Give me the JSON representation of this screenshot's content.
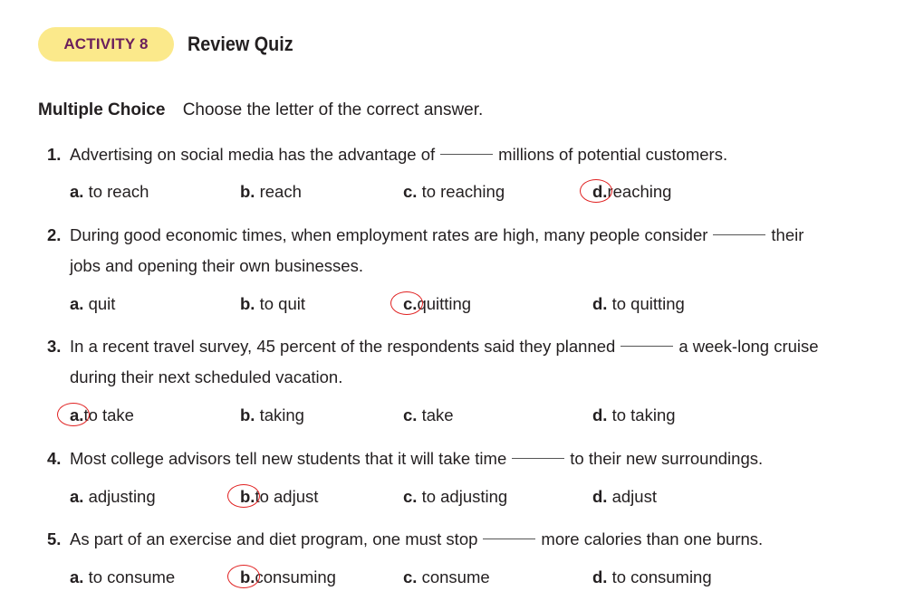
{
  "header": {
    "badge": "ACTIVITY 8",
    "title": "Review Quiz"
  },
  "section": {
    "heading": "Multiple Choice",
    "instruction": "Choose the letter of the correct answer."
  },
  "questions": [
    {
      "num": "1.",
      "before": "Advertising on social media has the advantage of",
      "after": "millions of potential customers.",
      "cont": "",
      "options": [
        {
          "letter": "a.",
          "text": "to reach"
        },
        {
          "letter": "b.",
          "text": "reach"
        },
        {
          "letter": "c.",
          "text": "to reaching"
        },
        {
          "letter": "d.",
          "text": "reaching"
        }
      ],
      "answer": 3
    },
    {
      "num": "2.",
      "before": "During good economic times, when employment rates are high, many people consider",
      "after": "their",
      "cont": "jobs and opening their own businesses.",
      "options": [
        {
          "letter": "a.",
          "text": "quit"
        },
        {
          "letter": "b.",
          "text": "to quit"
        },
        {
          "letter": "c.",
          "text": "quitting"
        },
        {
          "letter": "d.",
          "text": "to quitting"
        }
      ],
      "answer": 2
    },
    {
      "num": "3.",
      "before": "In a recent travel survey, 45 percent of the respondents said they planned",
      "after": "a week-long cruise",
      "cont": "during their next scheduled vacation.",
      "options": [
        {
          "letter": "a.",
          "text": "to take"
        },
        {
          "letter": "b.",
          "text": "taking"
        },
        {
          "letter": "c.",
          "text": "take"
        },
        {
          "letter": "d.",
          "text": "to taking"
        }
      ],
      "answer": 0
    },
    {
      "num": "4.",
      "before": "Most college advisors tell new students that it will take time",
      "after": "to their new surroundings.",
      "cont": "",
      "options": [
        {
          "letter": "a.",
          "text": "adjusting"
        },
        {
          "letter": "b.",
          "text": "to adjust"
        },
        {
          "letter": "c.",
          "text": "to adjusting"
        },
        {
          "letter": "d.",
          "text": "adjust"
        }
      ],
      "answer": 1
    },
    {
      "num": "5.",
      "before": "As part of an exercise and diet program, one must stop",
      "after": "more calories than one burns.",
      "cont": "",
      "options": [
        {
          "letter": "a.",
          "text": "to consume"
        },
        {
          "letter": "b.",
          "text": "consuming"
        },
        {
          "letter": "c.",
          "text": "consume"
        },
        {
          "letter": "d.",
          "text": "to consuming"
        }
      ],
      "answer": 1
    }
  ]
}
